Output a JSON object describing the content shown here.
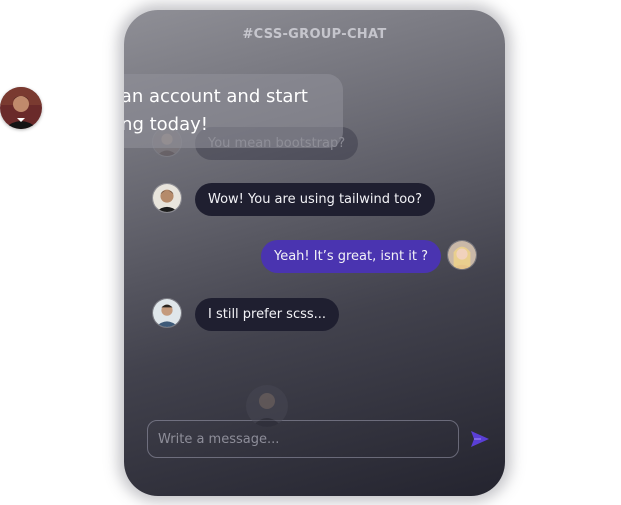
{
  "chat": {
    "title": "#CSS-GROUP-CHAT",
    "messages": [
      {
        "text": "You mean bootstrap?",
        "side": "left"
      },
      {
        "text": "Wow! You are using tailwind too?",
        "side": "left"
      },
      {
        "text": "Yeah! It’s great, isnt it ?",
        "side": "right"
      },
      {
        "text": "I still prefer scss...",
        "side": "left"
      }
    ],
    "input_placeholder": "Write a message...",
    "send_icon": "send-icon"
  },
  "overlay": {
    "line1": "e an account and start",
    "line2": "ting today!"
  },
  "colors": {
    "bubble_dark": "#1f1f30",
    "bubble_accent": "#4a34b0",
    "send_icon": "#5a3fd6"
  }
}
